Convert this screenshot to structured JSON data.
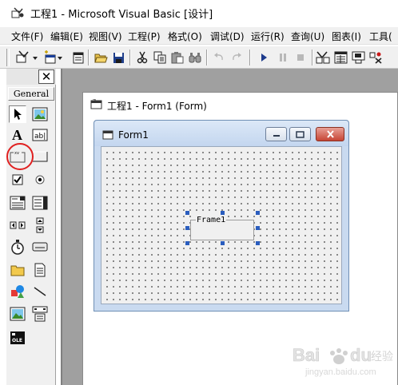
{
  "window": {
    "title": "工程1 - Microsoft Visual Basic [设计]"
  },
  "menubar": {
    "items": [
      {
        "label": "文件(F)"
      },
      {
        "label": "编辑(E)"
      },
      {
        "label": "视图(V)"
      },
      {
        "label": "工程(P)"
      },
      {
        "label": "格式(O)"
      },
      {
        "label": "调试(D)"
      },
      {
        "label": "运行(R)"
      },
      {
        "label": "查询(U)"
      },
      {
        "label": "图表(I)"
      },
      {
        "label": "工具("
      }
    ]
  },
  "toolbar": {
    "buttons": [
      "add-project-icon",
      "add-form-icon",
      "menu-editor-icon",
      "open-project-icon",
      "save-project-icon",
      "cut-icon",
      "copy-icon",
      "paste-icon",
      "find-icon",
      "undo-icon",
      "redo-icon",
      "start-icon",
      "break-icon",
      "end-icon",
      "project-explorer-icon",
      "properties-window-icon",
      "form-layout-icon",
      "toolbox-icon"
    ]
  },
  "toolbox": {
    "close_label": "✕",
    "tab_label": "General",
    "tools": [
      "pointer",
      "picturebox",
      "label",
      "textbox",
      "frame",
      "commandbutton",
      "checkbox",
      "optionbutton",
      "combobox",
      "listbox",
      "hscrollbar",
      "vscrollbar",
      "timer",
      "drivelistbox",
      "dirlistbox",
      "filelistbox",
      "shape",
      "line",
      "image",
      "data",
      "ole"
    ],
    "highlighted_tool": "frame"
  },
  "designer": {
    "title": "工程1 - Form1 (Form)"
  },
  "form": {
    "title": "Form1"
  },
  "frame_control": {
    "caption": "Frame1"
  },
  "watermark": {
    "brand": "Baidu 经验",
    "url": "jingyan.baidu.com"
  },
  "colors": {
    "selection_highlight": "#e02020",
    "handle": "#2a5dbe",
    "mdi_background": "#a0a0a0"
  }
}
